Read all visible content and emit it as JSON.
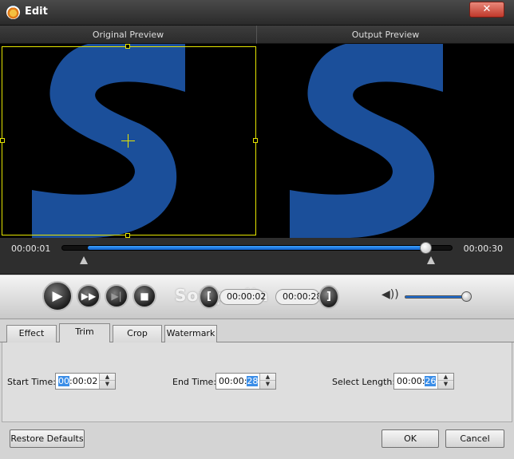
{
  "window": {
    "title": "Edit",
    "close_symbol": "✕",
    "app_icon": "app-logo-icon"
  },
  "preview": {
    "original_label": "Original Preview",
    "output_label": "Output Preview",
    "brand_color": "#1b4f9a"
  },
  "timeline": {
    "start_time": "00:00:01",
    "end_time": "00:00:30",
    "progress": 0.93,
    "trim_start": 0.07,
    "trim_end": 0.93
  },
  "playback": {
    "play_symbol": "▶",
    "fast_forward_symbol": "▶▶",
    "next_frame_symbol": "▶|",
    "stop_symbol": "■",
    "segment_start_symbol": "[",
    "segment_end_symbol": "]",
    "segment_start_time": "00:00:02",
    "segment_end_time": "00:00:28",
    "watermark": "Softpedia",
    "volume_symbol": "◀))",
    "volume_level": 0.9
  },
  "tabs": [
    {
      "label": "Effect",
      "active": false
    },
    {
      "label": "Trim",
      "active": true
    },
    {
      "label": "Crop",
      "active": false
    },
    {
      "label": "Watermark",
      "active": false
    }
  ],
  "trim": {
    "start_label": "Start Time:",
    "start_sel": "00",
    "start_rest": ":00:02",
    "end_label": "End Time:",
    "end_prefix": "00:00:",
    "end_sel": "28",
    "length_label": "Select Length:",
    "length_prefix": "00:00:",
    "length_sel": "26",
    "spin_up": "▲",
    "spin_down": "▼"
  },
  "footer": {
    "defaults_label": "Restore Defaults",
    "ok_label": "OK",
    "cancel_label": "Cancel"
  }
}
